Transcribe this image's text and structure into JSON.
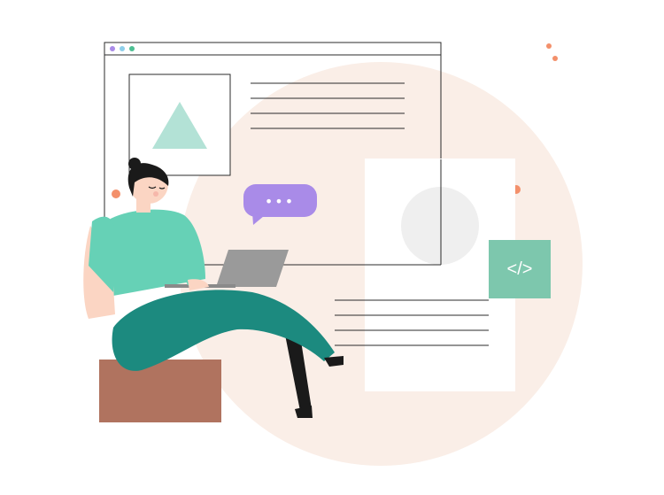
{
  "illustration": {
    "code_badge_text": "</>",
    "chat_bubble_text": "•••",
    "colors": {
      "background_circle": "#faeee7",
      "window_stroke": "#2b2b2b",
      "dot_purple": "#a98be8",
      "dot_blue": "#8ecfea",
      "dot_green": "#4dbf93",
      "triangle": "#b3e2d6",
      "placeholder_circle": "#efefef",
      "code_badge": "#7dc7ad",
      "chat_bubble": "#a98be8",
      "accent_dot": "#f3906b",
      "shirt": "#66d1b6",
      "pants": "#1c8a7f",
      "skin": "#fbd5c3",
      "hair": "#1a1a1a",
      "box": "#b0735f",
      "laptop": "#9a9a9a"
    }
  }
}
